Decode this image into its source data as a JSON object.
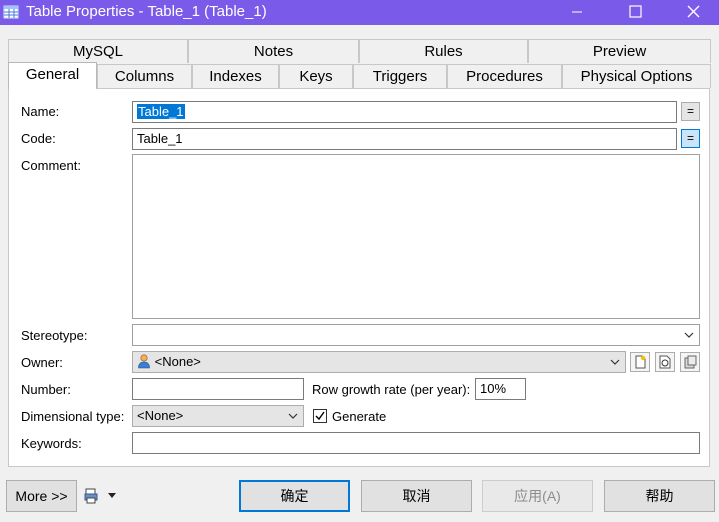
{
  "window": {
    "title": "Table Properties - Table_1 (Table_1)",
    "controls": {
      "minimize": "minimize-icon",
      "maximize": "maximize-icon",
      "close": "close-icon"
    }
  },
  "tabs_row1": [
    "MySQL",
    "Notes",
    "Rules",
    "Preview"
  ],
  "tabs_row2": [
    "General",
    "Columns",
    "Indexes",
    "Keys",
    "Triggers",
    "Procedures",
    "Physical Options"
  ],
  "active_tab": "General",
  "form": {
    "name_label": "Name:",
    "name_value": "Table_1",
    "code_label": "Code:",
    "code_value": "Table_1",
    "eq_label": "=",
    "comment_label": "Comment:",
    "comment_value": "",
    "stereotype_label": "Stereotype:",
    "stereotype_value": "",
    "owner_label": "Owner:",
    "owner_value": "<None>",
    "number_label": "Number:",
    "number_value": "",
    "row_growth_label": "Row growth rate (per year):",
    "row_growth_value": "10%",
    "dimensional_label": "Dimensional type:",
    "dimensional_value": "<None>",
    "generate_label": "Generate",
    "generate_checked": true,
    "keywords_label": "Keywords:",
    "keywords_value": ""
  },
  "buttons": {
    "more": "More >>",
    "ok": "确定",
    "cancel": "取消",
    "apply": "应用(A)",
    "help": "帮助"
  },
  "colors": {
    "titlebar": "#7a5ae8",
    "accent": "#0078d7",
    "selection": "#0078d7"
  }
}
